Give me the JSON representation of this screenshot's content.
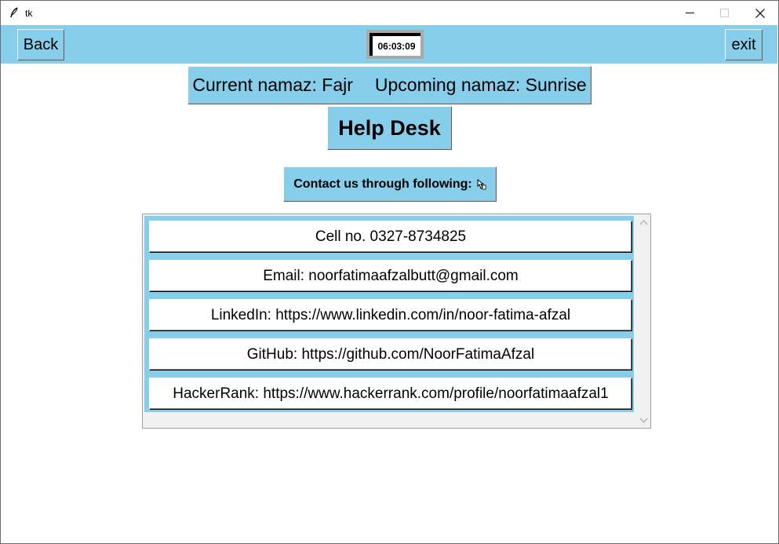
{
  "window": {
    "title": "tk"
  },
  "toolbar": {
    "back_label": "Back",
    "exit_label": "exit",
    "clock": "06:03:09"
  },
  "namaz": {
    "current": "Current namaz: Fajr",
    "upcoming": "Upcoming namaz: Sunrise"
  },
  "page": {
    "heading": "Help Desk",
    "contact_label": "Contact us through following:"
  },
  "contacts": [
    "Cell no. 0327-8734825",
    "Email: noorfatimaafzalbutt@gmail.com",
    "LinkedIn: https://www.linkedin.com/in/noor-fatima-afzal",
    "GitHub: https://github.com/NoorFatimaAfzal",
    "HackerRank: https://www.hackerrank.com/profile/noorfatimaafzal1"
  ],
  "colors": {
    "accent": "#87ceeb",
    "background": "#ffffff"
  },
  "icons": [
    "feather-icon",
    "minimize-icon",
    "maximize-icon",
    "close-icon",
    "hand-pointer-icon",
    "scroll-up-icon",
    "scroll-down-icon"
  ]
}
